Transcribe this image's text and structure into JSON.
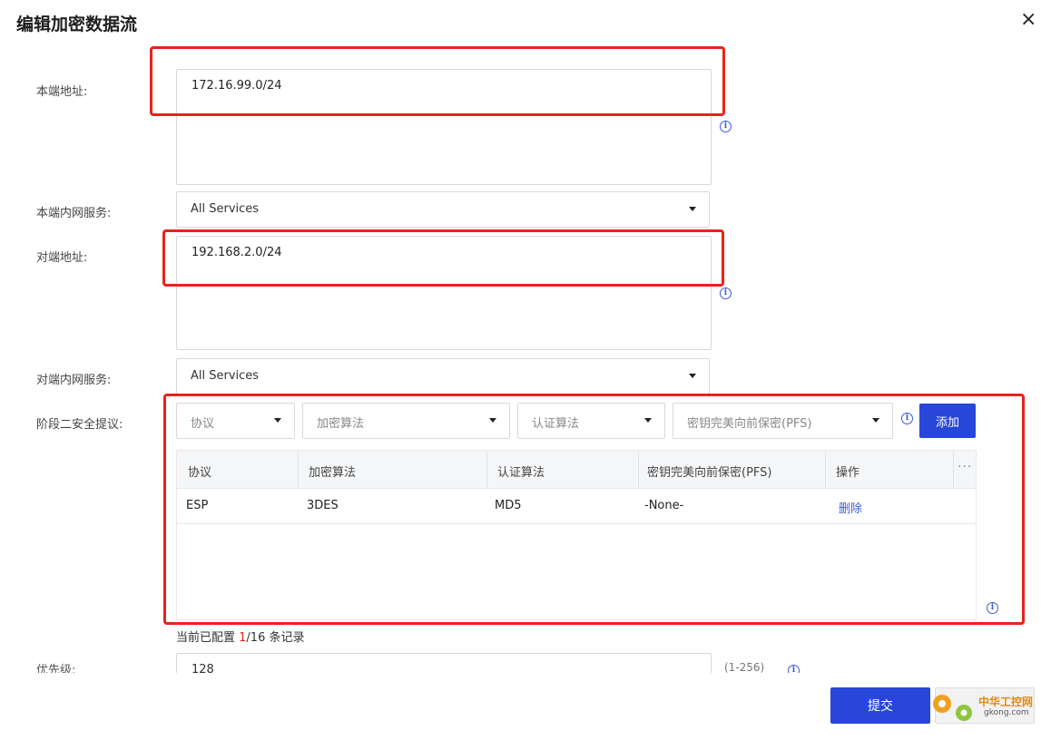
{
  "dialog": {
    "title": "编辑加密数据流",
    "close_icon": "×"
  },
  "local_address": {
    "label": "本端地址:",
    "value": "172.16.99.0/24"
  },
  "local_service": {
    "label": "本端内网服务:",
    "value": "All Services"
  },
  "peer_address": {
    "label": "对端地址:",
    "value": "192.168.2.0/24"
  },
  "peer_service": {
    "label": "对端内网服务:",
    "value": "All Services"
  },
  "phase2": {
    "label": "阶段二安全提议:",
    "protocol_placeholder": "协议",
    "encryption_placeholder": "加密算法",
    "auth_placeholder": "认证算法",
    "pfs_placeholder": "密钥完美向前保密(PFS)",
    "add_button": "添加",
    "table": {
      "headers": [
        "协议",
        "加密算法",
        "认证算法",
        "密钥完美向前保密(PFS)",
        "操作"
      ],
      "rows": [
        {
          "protocol": "ESP",
          "encryption": "3DES",
          "auth": "MD5",
          "pfs": "-None-",
          "action": "删除"
        }
      ],
      "more_icon": "···"
    },
    "record_prefix": "当前已配置 ",
    "record_current": "1",
    "record_suffix": "/16 条记录"
  },
  "priority": {
    "label": "优先级:",
    "value": "128",
    "range": "(1-256)"
  },
  "footer": {
    "submit": "提交"
  },
  "watermark": {
    "text": "中华工控网",
    "sub": "gkong.com"
  },
  "colors": {
    "primary": "#2846d8",
    "highlight": "#e8231c",
    "info": "#3b5bdb"
  }
}
